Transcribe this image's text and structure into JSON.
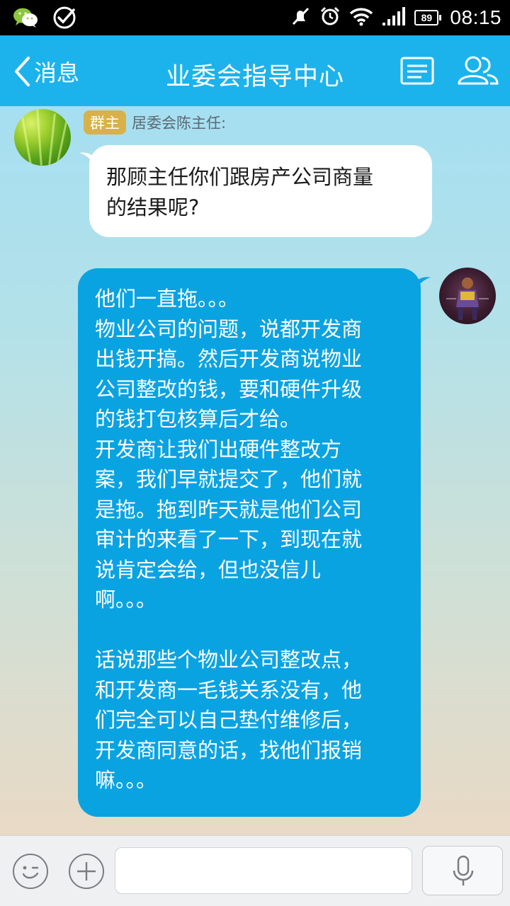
{
  "status_bar": {
    "time": "08:15",
    "battery_level": "89",
    "icons": [
      "wechat-icon",
      "check-circle-icon",
      "mute-icon",
      "alarm-icon",
      "wifi-icon",
      "signal-icon",
      "battery-icon"
    ]
  },
  "header": {
    "back_label": "消息",
    "title": "业委会指导中心",
    "actions": [
      "group-profile-icon",
      "members-icon"
    ]
  },
  "messages": [
    {
      "direction": "incoming",
      "role_badge": "群主",
      "sender": "居委会陈主任:",
      "lines": [
        "那顾主任你们跟房产公司商量",
        "的结果呢?"
      ]
    },
    {
      "direction": "outgoing",
      "lines": [
        "他们一直拖。。。",
        "物业公司的问题，说都开发商",
        "出钱开搞。然后开发商说物业",
        "公司整改的钱，要和硬件升级",
        "的钱打包核算后才给。",
        "开发商让我们出硬件整改方",
        "案，我们早就提交了，他们就",
        "是拖。拖到昨天就是他们公司",
        "审计的来看了一下，到现在就",
        "说肯定会给，但也没信儿",
        "啊。。。",
        "",
        "话说那些个物业公司整改点，",
        "和开发商一毛钱关系没有，他",
        "们完全可以自己垫付维修后，",
        "开发商同意的话，找他们报销",
        "嘛。。。"
      ]
    }
  ],
  "input_bar": {
    "text_value": "",
    "buttons": [
      "emoji-icon",
      "plus-icon",
      "microphone-icon"
    ]
  },
  "colors": {
    "header_bg": "#1cb3ec",
    "outgoing_bubble": "#0aa3e2",
    "incoming_bubble": "#ffffff",
    "badge": "#d8b14a"
  }
}
